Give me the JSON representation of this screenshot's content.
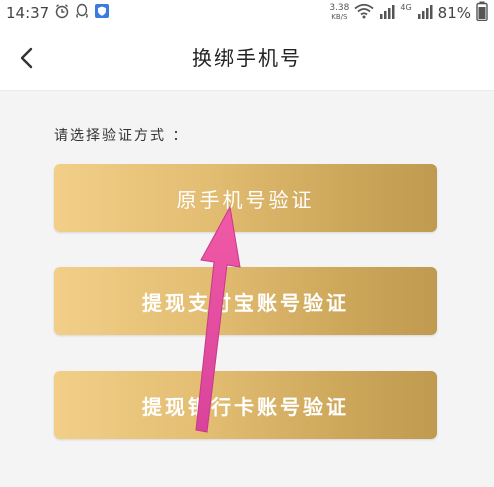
{
  "status_bar": {
    "time": "14:37",
    "speed_value": "3.38",
    "speed_unit": "KB/S",
    "network_label": "4G",
    "battery": "81%"
  },
  "header": {
    "title": "换绑手机号"
  },
  "main": {
    "prompt": "请选择验证方式 ：",
    "options": [
      {
        "label": "原手机号验证"
      },
      {
        "label": "提现支付宝账号验证"
      },
      {
        "label": "提现银行卡账号验证"
      }
    ]
  },
  "colors": {
    "option_gradient_start": "#f2cf88",
    "option_gradient_end": "#bf9a50",
    "annotation_arrow": "#e84a9b"
  }
}
